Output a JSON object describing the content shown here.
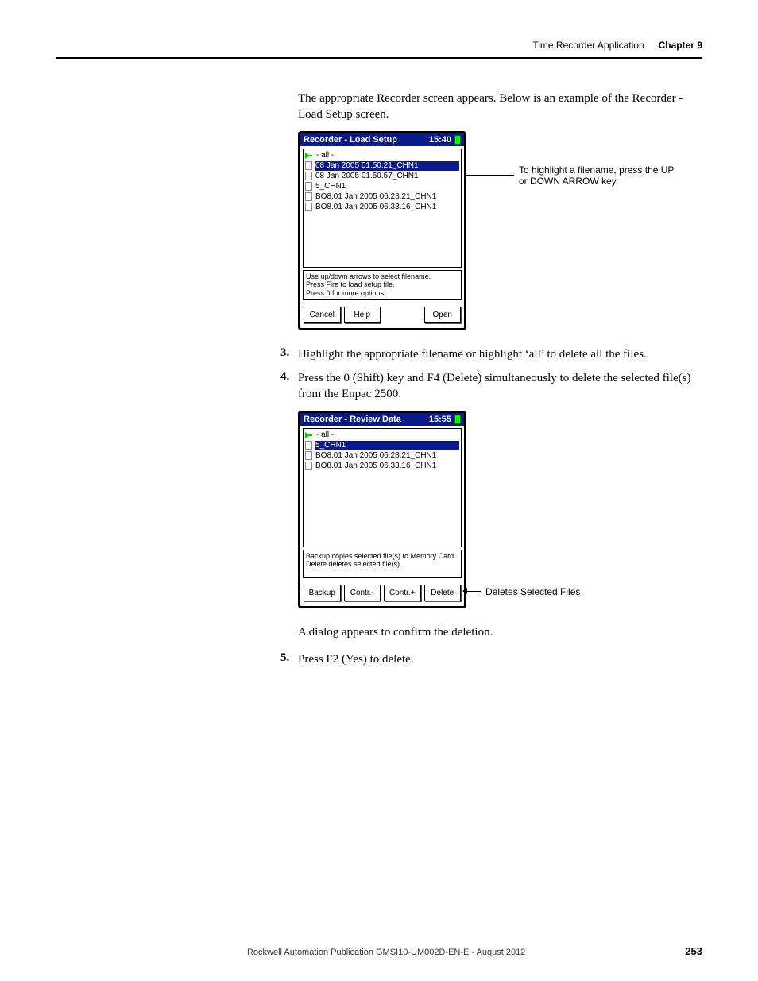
{
  "header": {
    "app_title": "Time Recorder Application",
    "chapter": "Chapter 9"
  },
  "intro": "The appropriate Recorder screen appears. Below is an example of the Recorder - Load Setup screen.",
  "screen1": {
    "title": "Recorder - Load Setup",
    "time": "15:40",
    "all_label": "- all -",
    "files": [
      "08 Jan 2005 01.50.21_CHN1",
      "08 Jan 2005 01.50.57_CHN1",
      "5_CHN1",
      "BO8.01 Jan 2005 06.28.21_CHN1",
      "BO8.01 Jan 2005 06.33.16_CHN1"
    ],
    "hint1": "Use up/down arrows to select filename.",
    "hint2": "Press Fire to load setup file.",
    "hint3": "Press 0 for more options.",
    "btn_cancel": "Cancel",
    "btn_help": "Help",
    "btn_open": "Open"
  },
  "callout1": "To highlight a filename, press the UP or DOWN ARROW key.",
  "step3": "Highlight the appropriate filename or highlight ‘all’ to delete all the files.",
  "step4": "Press the 0 (Shift) key and F4 (Delete) simultaneously to delete the selected file(s) from the Enpac 2500.",
  "screen2": {
    "title": "Recorder - Review Data",
    "time": "15:55",
    "all_label": "- all -",
    "files": [
      "5_CHN1",
      "BO8.01 Jan 2005 06.28.21_CHN1",
      "BO8.01 Jan 2005 06.33.16_CHN1"
    ],
    "hint1": "Backup copies selected file(s) to Memory Card.",
    "hint2": "Delete deletes selected file(s).",
    "btn_backup": "Backup",
    "btn_contr_minus": "Contr.-",
    "btn_contr_plus": "Contr.+",
    "btn_delete": "Delete"
  },
  "callout2": "Deletes Selected Files",
  "post_para": "A dialog appears to confirm the deletion.",
  "step5": "Press F2 (Yes) to delete.",
  "footer": {
    "publication": "Rockwell Automation Publication GMSI10-UM002D-EN-E - August 2012",
    "page": "253"
  }
}
